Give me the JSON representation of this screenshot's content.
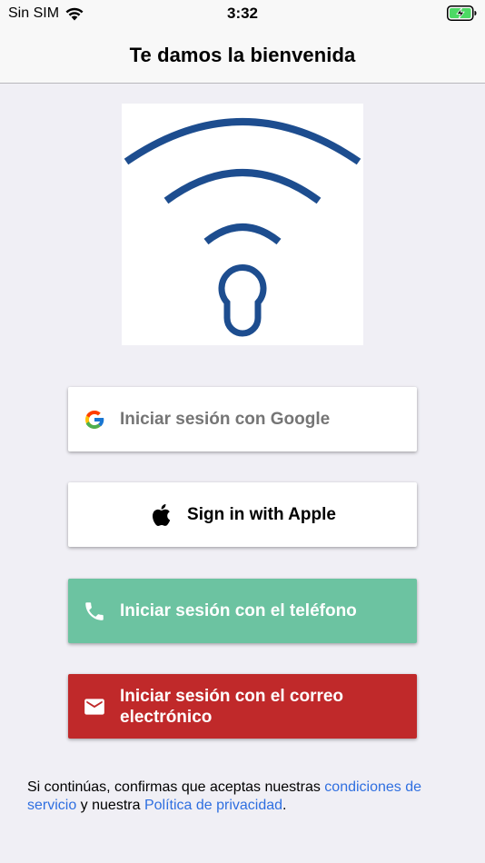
{
  "status_bar": {
    "carrier": "Sin SIM",
    "time": "3:32"
  },
  "nav": {
    "title": "Te damos la bienvenida"
  },
  "logo": {
    "icon": "wifi-keyhole-logo",
    "color": "#1d4d8f"
  },
  "buttons": {
    "google": {
      "label": "Iniciar sesión con Google",
      "icon": "google-icon"
    },
    "apple": {
      "label": "Sign in with Apple",
      "icon": "apple-icon"
    },
    "phone": {
      "label": "Iniciar sesión con el teléfono",
      "icon": "phone-icon",
      "color": "#6cc3a1"
    },
    "email": {
      "label": "Iniciar sesión con el correo electrónico",
      "icon": "mail-icon",
      "color": "#c0292a"
    }
  },
  "terms": {
    "prefix": "Si continúas, confirmas que aceptas nuestras ",
    "terms_link": "condiciones de servicio",
    "middle": " y nuestra ",
    "privacy_link": "Política de privacidad",
    "suffix": "."
  }
}
